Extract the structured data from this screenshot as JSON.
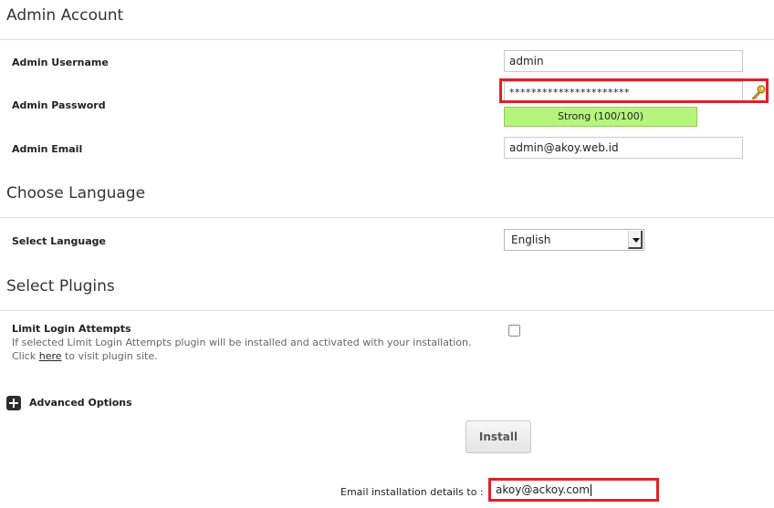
{
  "admin_account": {
    "title": "Admin Account",
    "username_label": "Admin Username",
    "username_value": "admin",
    "password_label": "Admin Password",
    "password_value": "**********************",
    "password_strength": "Strong (100/100)",
    "email_label": "Admin Email",
    "email_value": "admin@akoy.web.id"
  },
  "language": {
    "title": "Choose Language",
    "select_label": "Select Language",
    "selected": "English"
  },
  "plugins": {
    "title": "Select Plugins",
    "plugin_name": "Limit Login Attempts",
    "desc_line1": "If selected Limit Login Attempts plugin will be installed and activated with your installation.",
    "desc_prefix": "Click ",
    "desc_link": "here",
    "desc_suffix": " to visit plugin site.",
    "checked": false
  },
  "advanced": {
    "label": "Advanced Options"
  },
  "install": {
    "button_label": "Install",
    "email_label": "Email installation details to :",
    "email_value": "akoy@ackoy.com"
  },
  "colors": {
    "highlight": "#e0202a",
    "strength_bg": "#b6f57c"
  }
}
